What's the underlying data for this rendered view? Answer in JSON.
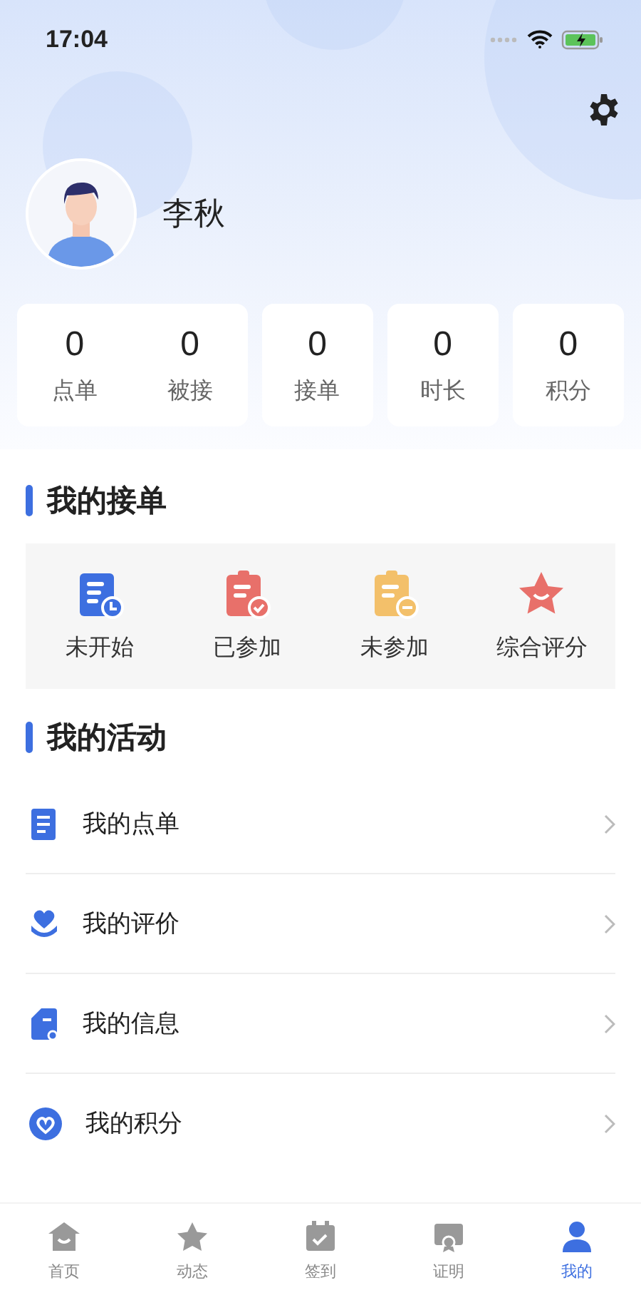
{
  "status_bar": {
    "time": "17:04"
  },
  "profile": {
    "name": "李秋"
  },
  "stat_cards": [
    {
      "items": [
        {
          "value": "0",
          "label": "点单"
        },
        {
          "value": "0",
          "label": "被接"
        }
      ]
    },
    {
      "items": [
        {
          "value": "0",
          "label": "接单"
        }
      ]
    },
    {
      "items": [
        {
          "value": "0",
          "label": "时长"
        }
      ]
    },
    {
      "items": [
        {
          "value": "0",
          "label": "积分"
        }
      ]
    }
  ],
  "orders_section": {
    "title": "我的接单",
    "items": [
      {
        "label": "未开始",
        "kind": "pending"
      },
      {
        "label": "已参加",
        "kind": "joined"
      },
      {
        "label": "未参加",
        "kind": "missed"
      },
      {
        "label": "综合评分",
        "kind": "rating"
      }
    ]
  },
  "activity_section": {
    "title": "我的活动",
    "items": [
      {
        "label": "我的点单",
        "kind": "orders"
      },
      {
        "label": "我的评价",
        "kind": "reviews"
      },
      {
        "label": "我的信息",
        "kind": "info"
      },
      {
        "label": "我的积分",
        "kind": "points"
      }
    ]
  },
  "tab_bar": [
    {
      "label": "首页",
      "kind": "home",
      "selected": false
    },
    {
      "label": "动态",
      "kind": "feed",
      "selected": false
    },
    {
      "label": "签到",
      "kind": "checkin",
      "selected": false
    },
    {
      "label": "证明",
      "kind": "proof",
      "selected": false
    },
    {
      "label": "我的",
      "kind": "me",
      "selected": true
    }
  ]
}
